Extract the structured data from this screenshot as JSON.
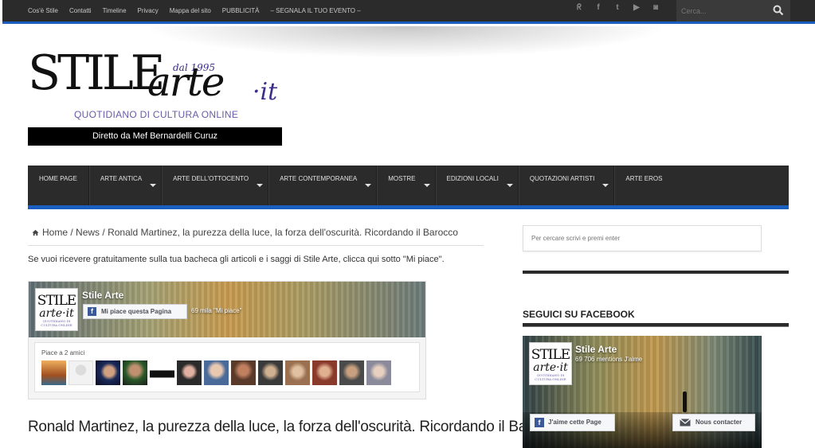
{
  "topnav": {
    "links": [
      "Cos'è Stile",
      "Contatti",
      "Timeline",
      "Privacy",
      "Mappa del sito",
      "PUBBLICITÀ",
      "– SEGNALA IL TUO EVENTO –"
    ],
    "social_icons": [
      "rss-icon",
      "facebook-icon",
      "twitter-icon",
      "youtube-icon",
      "instagram-icon"
    ],
    "social_glyphs": [
      "ᖇ",
      "f",
      "t",
      "▶",
      "◙"
    ],
    "search_placeholder": "Cerca..."
  },
  "logo": {
    "stile": "STILE",
    "arte": "arte",
    "it": "·it",
    "since": "dal 1995",
    "tagline": "QUOTIDIANO DI CULTURA ONLINE"
  },
  "director": "Diretto da Mef Bernardelli Curuz",
  "mainnav": [
    {
      "label": "HOME PAGE",
      "dropdown": false
    },
    {
      "label": "ARTE ANTICA",
      "dropdown": true
    },
    {
      "label": "ARTE DELL'OTTOCENTO",
      "dropdown": true
    },
    {
      "label": "ARTE CONTEMPORANEA",
      "dropdown": true
    },
    {
      "label": "MOSTRE",
      "dropdown": true
    },
    {
      "label": "EDIZIONI LOCALI",
      "dropdown": true
    },
    {
      "label": "QUOTAZIONI ARTISTI",
      "dropdown": true
    },
    {
      "label": "ARTE EROS",
      "dropdown": false
    }
  ],
  "breadcrumb": {
    "home": "Home",
    "sep": "/",
    "section": "News",
    "current": "Ronald Martinez, la purezza della luce, la forza dell'oscurità. Ricordando il Barocco"
  },
  "intro": "Se vuoi ricevere gratuitamente sulla tua bacheca gli articoli e i saggi di Stile Arte, clicca qui sotto \"Mi piace\".",
  "fb_widget": {
    "page_name": "Stile Arte",
    "like_label": "Mi piace questa Pagina",
    "count": "69 mila \"Mi piace\"",
    "friends_label": "Piace a 2 amici",
    "logo_a": "STILE",
    "logo_b": "arte·it",
    "logo_c": "QUOTIDIANO DI CULTURA ONLINE"
  },
  "article_title": "Ronald Martinez, la purezza della luce, la forza dell'oscurità. Ricordando il Barocco",
  "sidebar": {
    "search_placeholder": "Per cercare scrivi e premi enter",
    "facebook_title": "SEGUICI SU FACEBOOK",
    "fb_page_name": "Stile Arte",
    "fb_mentions": "69 706 mentions J'aime",
    "fb_like": "J'aime cette Page",
    "fb_contact": "Nous contacter"
  },
  "colors": {
    "accent": "#1a5fbf",
    "dark": "#2b2b2b",
    "facebook": "#3b5998",
    "logo_purple": "#3b2d8a"
  }
}
